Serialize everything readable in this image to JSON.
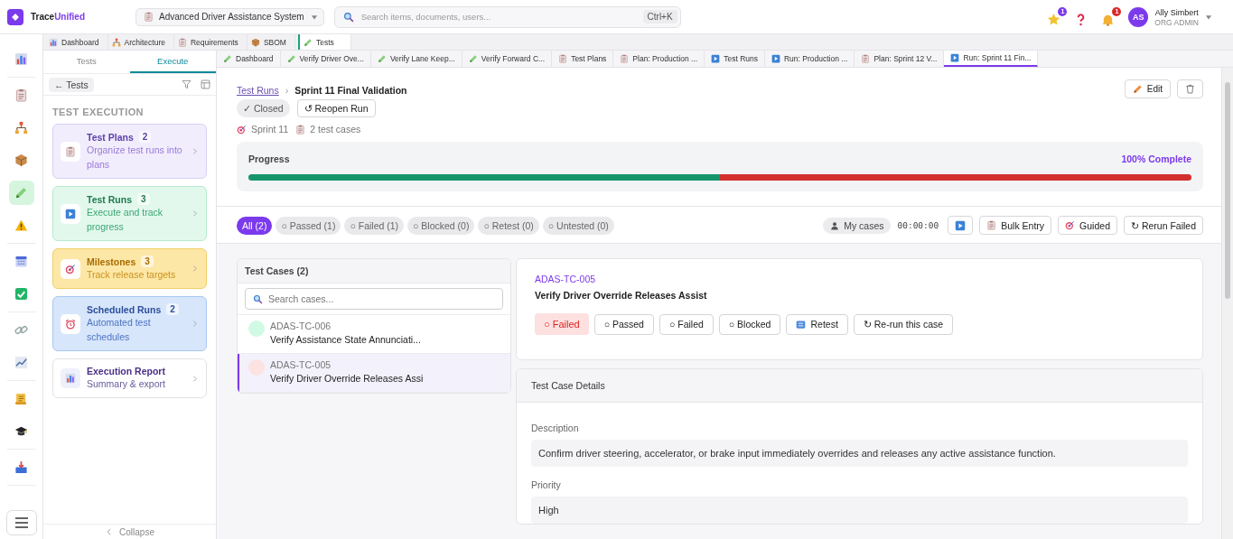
{
  "brand": {
    "first": "Trace",
    "second": "Unified"
  },
  "project": {
    "name": "Advanced Driver Assistance System"
  },
  "search": {
    "placeholder": "Search items, documents, users...",
    "shortcut": "Ctrl+K"
  },
  "header_icons": [
    {
      "kind": "star",
      "badge": "1"
    },
    {
      "kind": "help"
    },
    {
      "kind": "bell",
      "badge": "1"
    }
  ],
  "user": {
    "initials": "AS",
    "name": "Ally Simbert",
    "role": "ORG ADMIN"
  },
  "rail": [
    [
      {
        "selected": false
      }
    ],
    [
      {
        "selected": false
      },
      {
        "selected": false
      },
      {
        "selected": false
      },
      {
        "selected": true
      },
      {
        "selected": false
      }
    ],
    [
      {
        "selected": false
      },
      {
        "selected": false
      }
    ],
    [
      {
        "selected": false
      },
      {
        "selected": false
      }
    ],
    [
      {
        "selected": false
      },
      {
        "selected": false
      }
    ],
    [
      {
        "selected": false
      }
    ]
  ],
  "module_tabs": [
    {
      "label": "Dashboard",
      "selected": false
    },
    {
      "label": "Architecture",
      "selected": false
    },
    {
      "label": "Requirements",
      "selected": false
    },
    {
      "label": "SBOM",
      "selected": false
    },
    {
      "label": "Tests",
      "selected": true
    }
  ],
  "sidebar": {
    "tabs": [
      {
        "label": "Tests",
        "selected": false
      },
      {
        "label": "Execute",
        "selected": true
      }
    ],
    "back_button": "← Tests",
    "section_title": "TEST EXECUTION",
    "cards": [
      {
        "kind": "plans",
        "title": "Test Plans",
        "count": "2",
        "subtitle": "Organize test runs into plans"
      },
      {
        "kind": "runs",
        "title": "Test Runs",
        "count": "3",
        "subtitle": "Execute and track progress"
      },
      {
        "kind": "milestones",
        "title": "Milestones",
        "count": "3",
        "subtitle": "Track release targets"
      },
      {
        "kind": "scheduled",
        "title": "Scheduled Runs",
        "count": "2",
        "subtitle": "Automated test schedules"
      },
      {
        "kind": "report",
        "title": "Execution Report",
        "subtitle": "Summary & export"
      }
    ],
    "collapse": "Collapse"
  },
  "doc_tabs": [
    {
      "label": "Dashboard",
      "selected": false
    },
    {
      "label": "Verify Driver Ove...",
      "selected": false
    },
    {
      "label": "Verify Lane Keep...",
      "selected": false
    },
    {
      "label": "Verify Forward C...",
      "selected": false
    },
    {
      "label": "Test Plans",
      "selected": false
    },
    {
      "label": "Plan: Production ...",
      "selected": false
    },
    {
      "label": "Test Runs",
      "selected": false
    },
    {
      "label": "Run: Production ...",
      "selected": false
    },
    {
      "label": "Plan: Sprint 12 V...",
      "selected": false
    },
    {
      "label": "Run: Sprint 11 Fin...",
      "selected": true
    }
  ],
  "run": {
    "breadcrumb": {
      "link": "Test Runs",
      "separator": "›",
      "current": "Sprint 11 Final Validation"
    },
    "status": "✓ Closed",
    "reopen_button": "↺ Reopen Run",
    "edit_button": "Edit",
    "meta": [
      "Sprint 11",
      "2 test cases"
    ],
    "progress": {
      "title": "Progress",
      "summary": "100% Complete",
      "segments": [
        {
          "kind": "passed",
          "level": 0.5
        },
        {
          "kind": "failed",
          "level": 0.5
        }
      ]
    },
    "filters": [
      {
        "label": "All (2)",
        "selected": true
      },
      {
        "label": "○ Passed (1)",
        "selected": false
      },
      {
        "label": "○ Failed (1)",
        "selected": false
      },
      {
        "label": "○ Blocked (0)",
        "selected": false
      },
      {
        "label": "○ Retest (0)",
        "selected": false
      },
      {
        "label": "○ Untested (0)",
        "selected": false
      }
    ],
    "my_cases": "My cases",
    "timer": "00:00:00",
    "actions": [
      "Bulk Entry",
      "Guided",
      "↻ Rerun Failed"
    ],
    "cases": {
      "title": "Test Cases (2)",
      "placeholder": "Search cases...",
      "items": [
        {
          "id": "ADAS-TC-006",
          "title": "Verify Assistance State Annunciati...",
          "color": "#d1fae5",
          "selected": false
        },
        {
          "id": "ADAS-TC-005",
          "title": "Verify Driver Override Releases Assi",
          "color": "#fde2e2",
          "selected": true
        }
      ]
    },
    "detail": {
      "id": "ADAS-TC-005",
      "title": "Verify Driver Override Releases Assist",
      "current_status": "○ Failed",
      "status_buttons": [
        "○ Passed",
        "○ Failed",
        "○ Blocked",
        "Retest",
        "↻ Re-run this case"
      ]
    },
    "details": {
      "title": "Test Case Details",
      "fields": [
        {
          "label": "Description",
          "value": "Confirm driver steering, accelerator, or brake input immediately overrides and releases any active assistance function."
        },
        {
          "label": "Priority",
          "value": "High"
        }
      ]
    }
  }
}
